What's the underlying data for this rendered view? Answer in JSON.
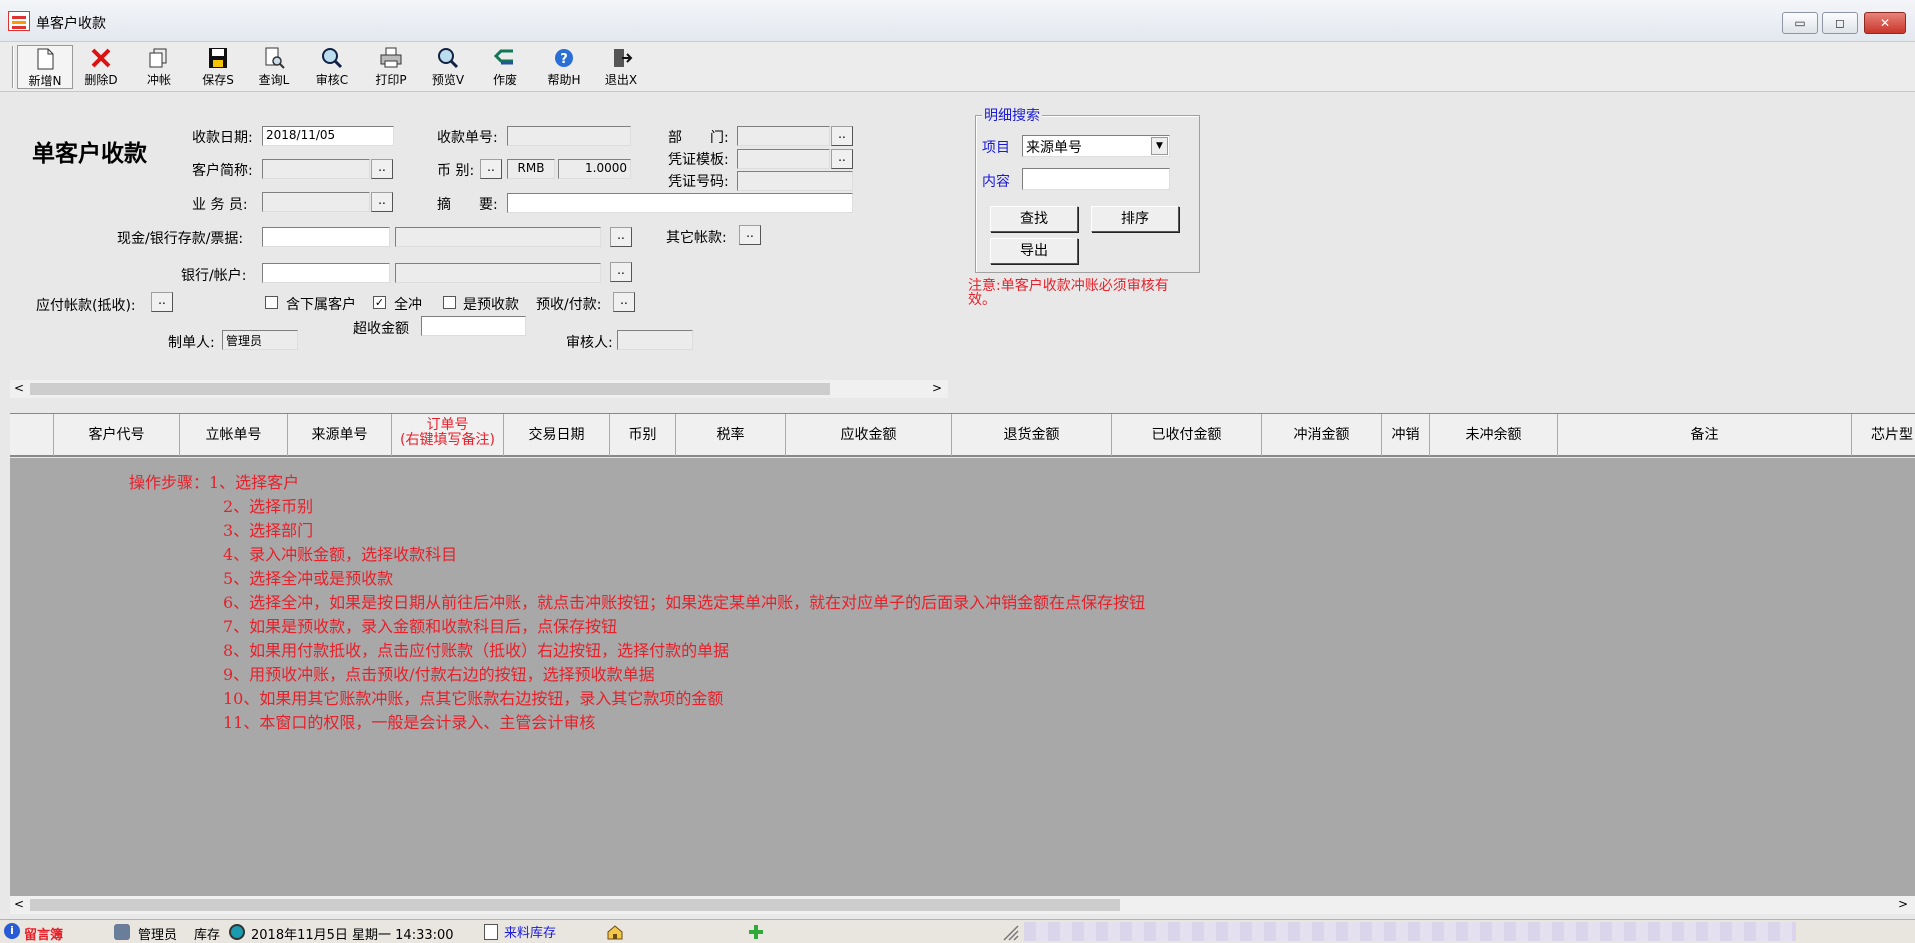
{
  "window": {
    "title": "单客户收款",
    "min": "▭",
    "max": "◻",
    "close": "✕"
  },
  "toolbar": [
    {
      "label": "新增N",
      "icon": "new-doc-icon"
    },
    {
      "label": "删除D",
      "icon": "delete-icon"
    },
    {
      "label": "冲帐",
      "icon": "offset-icon"
    },
    {
      "label": "保存S",
      "icon": "save-icon"
    },
    {
      "label": "查询L",
      "icon": "query-icon"
    },
    {
      "label": "审核C",
      "icon": "audit-icon"
    },
    {
      "label": "打印P",
      "icon": "print-icon"
    },
    {
      "label": "预览V",
      "icon": "preview-icon"
    },
    {
      "label": "作废",
      "icon": "void-icon"
    },
    {
      "label": "帮助H",
      "icon": "help-icon"
    },
    {
      "label": "退出X",
      "icon": "exit-icon"
    }
  ],
  "form": {
    "heading": "单客户收款",
    "date_label": "收款日期:",
    "date_value": "2018/11/05",
    "receipt_no_label": "收款单号:",
    "dept_label": "部　　门:",
    "voucher_template_label": "凭证模板:",
    "voucher_no_label": "凭证号码:",
    "customer_label": "客户简称:",
    "currency_label": "币 别:",
    "currency_code": "RMB",
    "rate": "1.0000",
    "salesman_label": "业 务 员:",
    "summary_label": "摘　　要:",
    "cash_label": "现金/银行存款/票据:",
    "other_label": "其它帐款:",
    "bank_label": "银行/帐户:",
    "payable_label": "应付帐款(抵收):",
    "include_sub_label": "含下属客户",
    "full_offset_label": "全冲",
    "prepay_label": "是预收款",
    "prepay_pay_label": "预收/付款:",
    "over_amount_label": "超收金额",
    "maker_label": "制单人:",
    "maker_value": "管理员",
    "auditor_label": "审核人:",
    "dots": ".."
  },
  "search": {
    "legend": "明细搜索",
    "item_label": "项目",
    "item_value": "来源单号",
    "content_label": "内容",
    "find": "查找",
    "sort": "排序",
    "export": "导出",
    "note": "注意:单客户收款冲账必须审核有效。"
  },
  "grid": {
    "columns": [
      "客户代号",
      "立帐单号",
      "来源单号",
      "订单号",
      "交易日期",
      "币别",
      "税率",
      "应收金额",
      "退货金额",
      "已收付金额",
      "冲消金额",
      "冲销",
      "未冲余额",
      "备注",
      "芯片型"
    ],
    "order_col_line1": "订单号",
    "order_col_line2": "(右键填写备注)"
  },
  "steps": [
    "操作步骤：1、选择客户",
    "2、选择币别",
    "3、选择部门",
    "4、录入冲账金额，选择收款科目",
    "5、选择全冲或是预收款",
    "6、选择全冲，如果是按日期从前往后冲账，就点击冲账按钮；如果选定某单冲账，就在对应单子的后面录入冲销金额在点保存按钮",
    "7、如果是预收款，录入金额和收款科目后，点保存按钮",
    "8、如果用付款抵收，点击应付账款（抵收）右边按钮，选择付款的单据",
    "9、用预收冲账，点击预收/付款右边的按钮，选择预收款单据",
    "10、如果用其它账款冲账，点其它账款右边按钮，录入其它款项的金额",
    "11、本窗口的权限，一般是会计录入、主管会计审核"
  ],
  "statusbar": {
    "guestbook": "留言簿",
    "user": "管理员",
    "module": "库存",
    "datetime": "2018年11月5日 星期一 14:33:00",
    "link": "来料库存"
  },
  "colors": {
    "accent_red": "#e8202a",
    "link_blue": "#1a1ad8",
    "grid_bg": "#a8a8a8"
  }
}
